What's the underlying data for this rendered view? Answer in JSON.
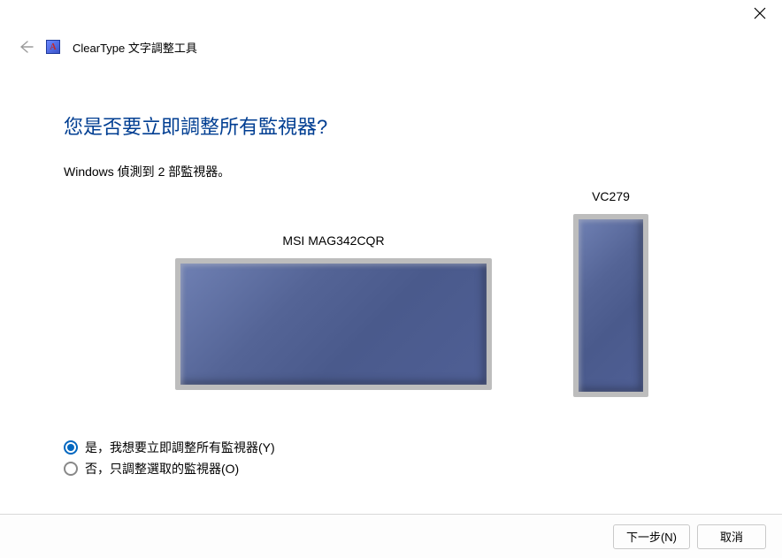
{
  "window": {
    "app_title": "ClearType 文字調整工具"
  },
  "page": {
    "heading": "您是否要立即調整所有監視器?",
    "detected_text": "Windows 偵測到 2 部監視器。"
  },
  "monitors": [
    {
      "name": "MSI MAG342CQR"
    },
    {
      "name": "VC279"
    }
  ],
  "options": {
    "tune_all": "是，我想要立即調整所有監視器(Y)",
    "tune_selected": "否，只調整選取的監視器(O)",
    "selected": "tune_all"
  },
  "footer": {
    "next": "下一步(N)",
    "cancel": "取消"
  }
}
